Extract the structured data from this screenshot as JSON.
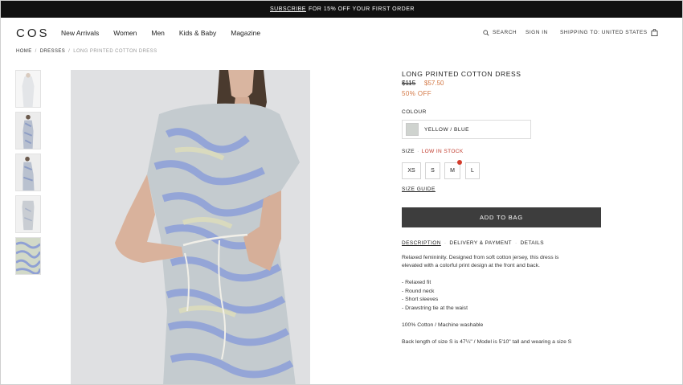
{
  "promo": {
    "link": "SUBSCRIBE",
    "text": "FOR 15% OFF YOUR FIRST ORDER"
  },
  "header": {
    "logo": "COS",
    "menu": [
      "New Arrivals",
      "Women",
      "Men",
      "Kids & Baby",
      "Magazine"
    ],
    "search": "SEARCH",
    "signin": "SIGN IN",
    "shipping": "SHIPPING TO: UNITED STATES",
    "search_icon": "search-icon",
    "bag_icon": "bag-icon"
  },
  "breadcrumb": [
    "HOME",
    "DRESSES",
    "LONG PRINTED COTTON DRESS"
  ],
  "product": {
    "title": "LONG PRINTED COTTON DRESS",
    "old_price": "$115",
    "new_price": "$57.50",
    "discount": "50% OFF",
    "colour_label": "COLOUR",
    "colour_value": "YELLOW / BLUE",
    "size_label": "SIZE",
    "stock": "LOW IN STOCK",
    "sizes": [
      "XS",
      "S",
      "M",
      "L"
    ],
    "size_guide": "SIZE GUIDE",
    "add_to_bag": "ADD TO BAG",
    "tabs": [
      "DESCRIPTION",
      "DELIVERY & PAYMENT",
      "DETAILS"
    ],
    "description": [
      "Relaxed femininity. Designed from soft cotton jersey, this dress is",
      "elevated with a colorful print design at the front and back.",
      "- Relaxed fit",
      "- Round neck",
      "- Short sleeves",
      "- Drawstring tie at the waist",
      "100% Cotton / Machine washable",
      "Back length of size S is 47¼\" / Model is 5'10\" tall and wearing a size S"
    ]
  },
  "colors": {
    "promo_bg": "#111111",
    "sale": "#d37845",
    "stock": "#c0392b",
    "button": "#3d3d3d"
  }
}
